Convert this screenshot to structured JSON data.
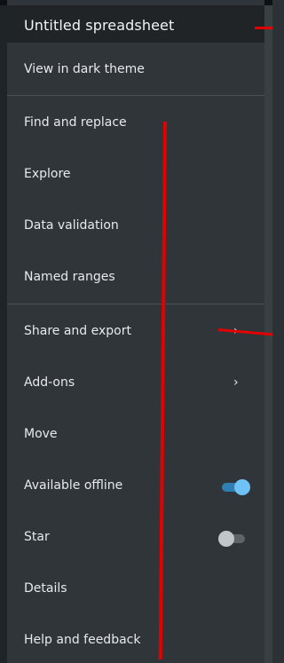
{
  "header": {
    "title": "Untitled spreadsheet"
  },
  "menu": {
    "view_dark_theme": "View in dark theme",
    "find_replace": "Find and replace",
    "explore": "Explore",
    "data_validation": "Data validation",
    "named_ranges": "Named ranges",
    "share_export": "Share and export",
    "addons": "Add-ons",
    "move": "Move",
    "available_offline": "Available offline",
    "star": "Star",
    "details": "Details",
    "help_feedback": "Help and feedback"
  },
  "toggles": {
    "available_offline": "on",
    "star": "off"
  },
  "glyphs": {
    "chevron": "›"
  },
  "colors": {
    "menu_background": "#2f3538",
    "header_background": "#202427",
    "toggle_on_thumb": "#6ec2f6",
    "toggle_off_thumb": "#c2c6c9",
    "annotation_red": "#e30000"
  }
}
